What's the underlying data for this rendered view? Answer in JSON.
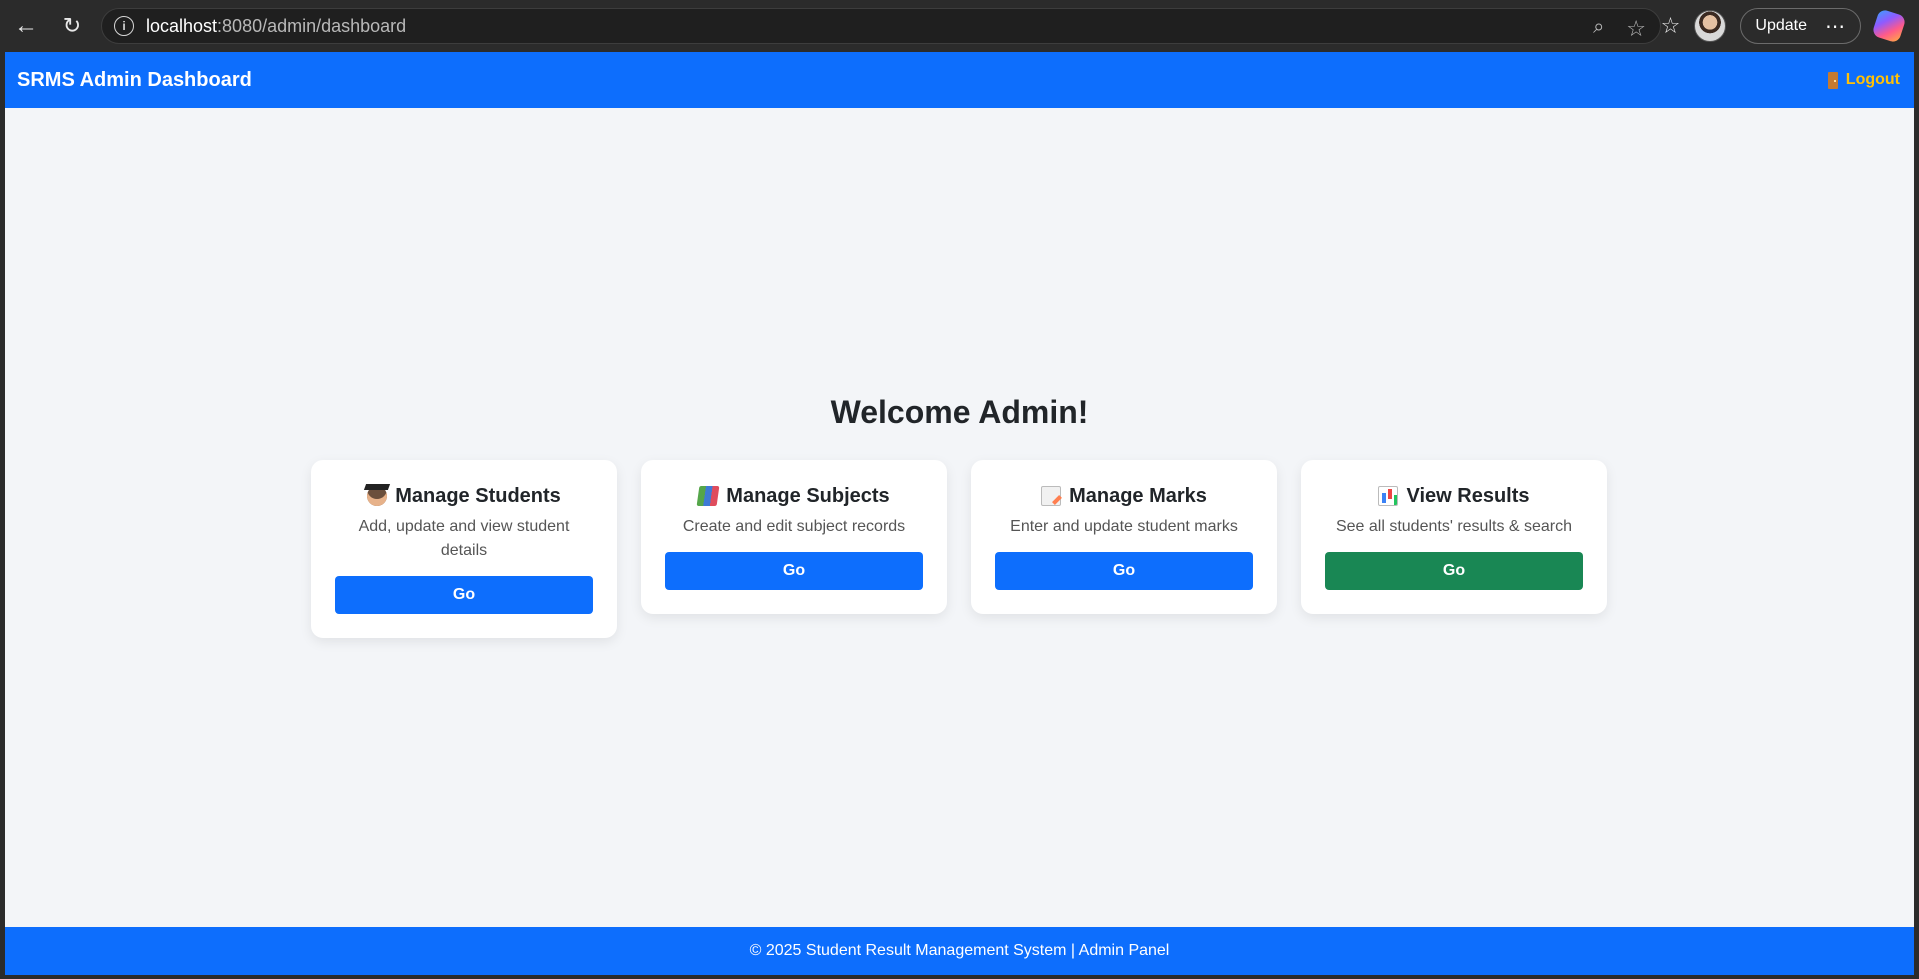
{
  "browser": {
    "url_host": "localhost",
    "url_path": ":8080/admin/dashboard",
    "update_label": "Update"
  },
  "header": {
    "title": "SRMS Admin Dashboard",
    "logout_label": "Logout"
  },
  "main": {
    "welcome": "Welcome Admin!",
    "cards": [
      {
        "icon": "student-icon",
        "title": "Manage Students",
        "description": "Add, update and view student details",
        "button": "Go",
        "button_color": "#0d6efd"
      },
      {
        "icon": "books-icon",
        "title": "Manage Subjects",
        "description": "Create and edit subject records",
        "button": "Go",
        "button_color": "#0d6efd"
      },
      {
        "icon": "memo-icon",
        "title": "Manage Marks",
        "description": "Enter and update student marks",
        "button": "Go",
        "button_color": "#0d6efd"
      },
      {
        "icon": "bar-chart-icon",
        "title": "View Results",
        "description": "See all students' results & search",
        "button": "Go",
        "button_color": "#198754"
      }
    ]
  },
  "footer": {
    "text": "© 2025 Student Result Management System | Admin Panel"
  },
  "colors": {
    "primary": "#0d6efd",
    "success": "#198754",
    "warning": "#ffc107",
    "background": "#f3f5f8"
  }
}
